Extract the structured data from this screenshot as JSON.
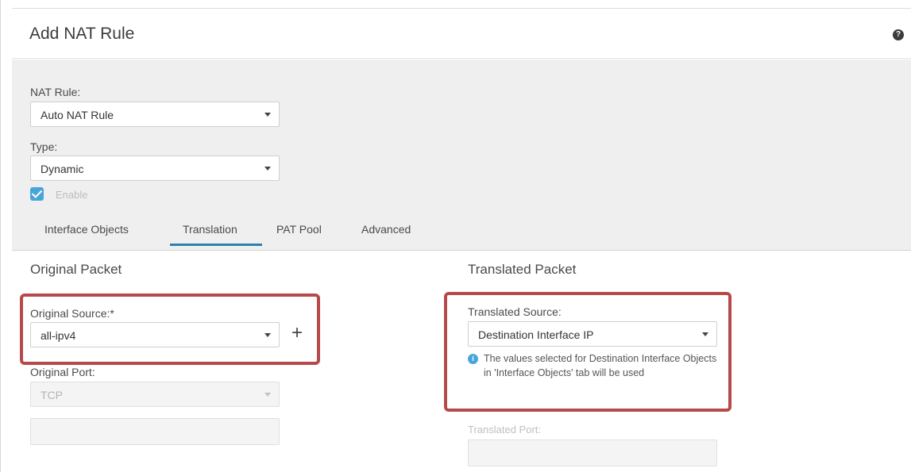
{
  "header": {
    "title": "Add NAT Rule",
    "help_icon": "?"
  },
  "top": {
    "nat_rule_label": "NAT Rule:",
    "nat_rule_value": "Auto NAT Rule",
    "type_label": "Type:",
    "type_value": "Dynamic",
    "enable_label": "Enable",
    "enable_checked": true
  },
  "tabs": [
    {
      "label": "Interface Objects",
      "active": false
    },
    {
      "label": "Translation",
      "active": true
    },
    {
      "label": "PAT Pool",
      "active": false
    },
    {
      "label": "Advanced",
      "active": false
    }
  ],
  "original": {
    "section_title": "Original Packet",
    "source_label": "Original Source:*",
    "source_value": "all-ipv4",
    "add_icon": "+",
    "port_label": "Original Port:",
    "port_value": "TCP",
    "port_input_value": ""
  },
  "translated": {
    "section_title": "Translated Packet",
    "source_label": "Translated Source:",
    "source_value": "Destination Interface IP",
    "info_icon": "i",
    "info_text": "The values selected for Destination Interface Objects in 'Interface Objects' tab will be used",
    "port_label": "Translated Port:",
    "port_input_value": ""
  },
  "colors": {
    "highlight": "#b64a4a",
    "accent": "#49a5d9",
    "tab_underline": "#2d7fae"
  }
}
